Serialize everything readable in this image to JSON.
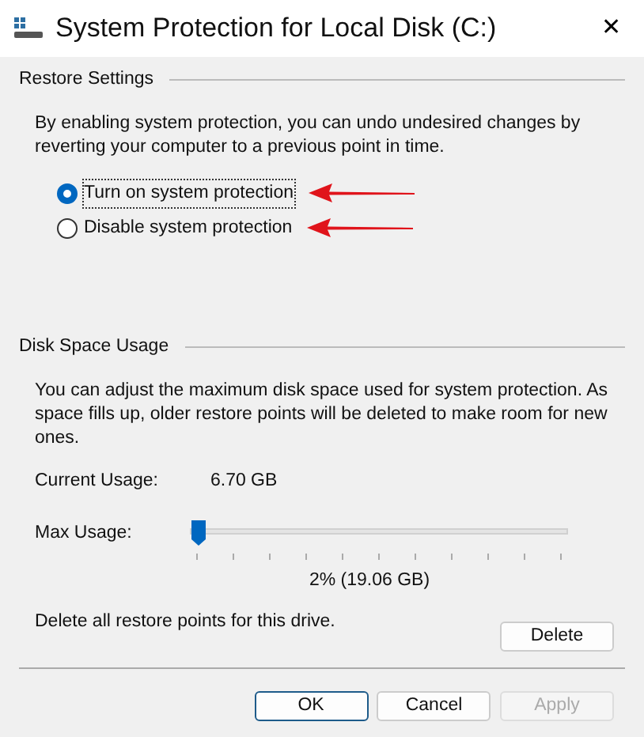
{
  "window": {
    "title": "System Protection for Local Disk (C:)",
    "close": "✕"
  },
  "restore_settings": {
    "heading": "Restore Settings",
    "description": "By enabling system protection, you can undo undesired changes by reverting your computer to a previous point in time.",
    "options": [
      {
        "label": "Turn on system protection",
        "selected": true
      },
      {
        "label": "Disable system protection",
        "selected": false
      }
    ]
  },
  "disk_space_usage": {
    "heading": "Disk Space Usage",
    "description": "You can adjust the maximum disk space used for system protection. As space fills up, older restore points will be deleted to make room for new ones.",
    "current_usage_label": "Current Usage:",
    "current_usage": "6.70 GB",
    "max_usage_label": "Max Usage:",
    "max_usage": {
      "level": 0.0
    },
    "max_usage_reading": "2% (19.06 GB)",
    "delete_text": "Delete all restore points for this drive.",
    "delete_button": "Delete"
  },
  "buttons": [
    {
      "label": "OK",
      "default": true,
      "disabled": false
    },
    {
      "label": "Cancel",
      "default": false,
      "disabled": false
    },
    {
      "label": "Apply",
      "default": false,
      "disabled": true
    }
  ]
}
